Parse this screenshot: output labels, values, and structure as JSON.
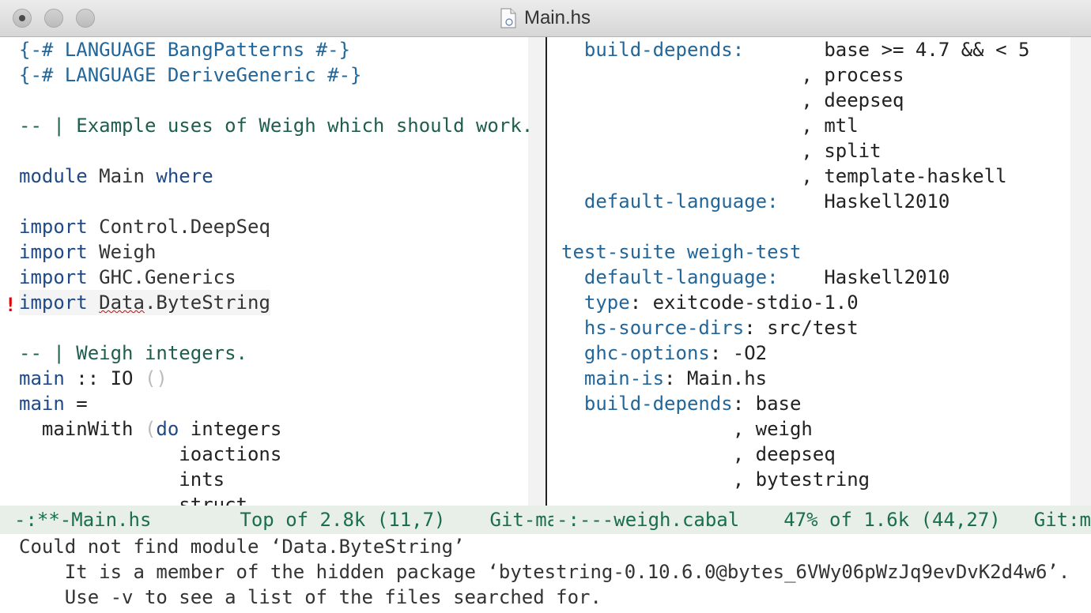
{
  "window": {
    "title": "Main.hs",
    "file_icon": "document-icon"
  },
  "left_pane": {
    "lines": [
      [
        {
          "c": "pragma",
          "t": "{-# LANGUAGE BangPatterns #-}"
        }
      ],
      [
        {
          "c": "pragma",
          "t": "{-# LANGUAGE DeriveGeneric #-}"
        }
      ],
      [],
      [
        {
          "c": "comment",
          "t": "-- | Example uses of Weigh which should work."
        }
      ],
      [],
      [
        {
          "c": "kw",
          "t": "module"
        },
        {
          "c": "mod",
          "t": " Main "
        },
        {
          "c": "kw",
          "t": "where"
        }
      ],
      [],
      [
        {
          "c": "kw",
          "t": "import"
        },
        {
          "c": "mod",
          "t": " Control.DeepSeq"
        }
      ],
      [
        {
          "c": "kw",
          "t": "import"
        },
        {
          "c": "mod",
          "t": " Weigh"
        }
      ],
      [
        {
          "c": "kw",
          "t": "import"
        },
        {
          "c": "mod",
          "t": " GHC.Generics"
        }
      ],
      [
        {
          "c": "kw",
          "t": "import"
        },
        {
          "c": "mod",
          "t": " "
        },
        {
          "c": "mod errword",
          "t": "Data"
        },
        {
          "c": "mod",
          "t": ".ByteString"
        }
      ],
      [],
      [
        {
          "c": "comment",
          "t": "-- | Weigh integers."
        }
      ],
      [
        {
          "c": "kw",
          "t": "main"
        },
        {
          "c": "plain",
          "t": " :: IO "
        },
        {
          "c": "paren",
          "t": "()"
        }
      ],
      [
        {
          "c": "kw",
          "t": "main"
        },
        {
          "c": "plain",
          "t": " ="
        }
      ],
      [
        {
          "c": "plain",
          "t": "  mainWith "
        },
        {
          "c": "paren",
          "t": "("
        },
        {
          "c": "kw",
          "t": "do"
        },
        {
          "c": "plain",
          "t": " integers"
        }
      ],
      [
        {
          "c": "plain",
          "t": "              ioactions"
        }
      ],
      [
        {
          "c": "plain",
          "t": "              ints"
        }
      ],
      [
        {
          "c": "plain",
          "t": "              struct"
        }
      ]
    ],
    "error_marker": "!"
  },
  "right_pane": {
    "lines": [
      [
        {
          "c": "field",
          "t": "  build-depends:"
        },
        {
          "c": "plain",
          "t": "       base >= 4.7 && < 5"
        }
      ],
      [
        {
          "c": "plain",
          "t": "                     , process"
        }
      ],
      [
        {
          "c": "plain",
          "t": "                     , deepseq"
        }
      ],
      [
        {
          "c": "plain",
          "t": "                     , mtl"
        }
      ],
      [
        {
          "c": "plain",
          "t": "                     , split"
        }
      ],
      [
        {
          "c": "plain",
          "t": "                     , template-haskell"
        }
      ],
      [
        {
          "c": "field",
          "t": "  default-language:"
        },
        {
          "c": "plain",
          "t": "    Haskell2010"
        }
      ],
      [],
      [
        {
          "c": "field",
          "t": "test-suite weigh-test"
        }
      ],
      [
        {
          "c": "field",
          "t": "  default-language:"
        },
        {
          "c": "plain",
          "t": "    Haskell2010"
        }
      ],
      [
        {
          "c": "field",
          "t": "  type"
        },
        {
          "c": "plain",
          "t": ": exitcode-stdio-1.0"
        }
      ],
      [
        {
          "c": "field",
          "t": "  hs-source-dirs"
        },
        {
          "c": "plain",
          "t": ": src/test"
        }
      ],
      [
        {
          "c": "field",
          "t": "  ghc-options"
        },
        {
          "c": "plain",
          "t": ": -O2"
        }
      ],
      [
        {
          "c": "field",
          "t": "  main-is"
        },
        {
          "c": "plain",
          "t": ": Main.hs"
        }
      ],
      [
        {
          "c": "field",
          "t": "  build-depends"
        },
        {
          "c": "plain",
          "t": ": base"
        }
      ],
      [
        {
          "c": "plain",
          "t": "               , weigh"
        }
      ],
      [
        {
          "c": "plain",
          "t": "               , deepseq"
        }
      ],
      [
        {
          "c": "plain",
          "t": "               , bytestring"
        }
      ]
    ]
  },
  "modeline_left": {
    "status": "-:**-",
    "buffer": "Main.hs",
    "position": "Top of 2.8k (11,7)",
    "vc": "Git-ma"
  },
  "modeline_right": {
    "status": "-:---",
    "buffer": "weigh.cabal",
    "position": "47% of 1.6k (44,27)",
    "vc": "Git:ma"
  },
  "echo_area": {
    "line1": "Could not find module ‘Data.ByteString’",
    "line2": "    It is a member of the hidden package ‘bytestring-0.10.6.0@bytes_6VWy06pWzJq9evDvK2d4w6’.",
    "line3": "    Use -v to see a list of the files searched for."
  }
}
